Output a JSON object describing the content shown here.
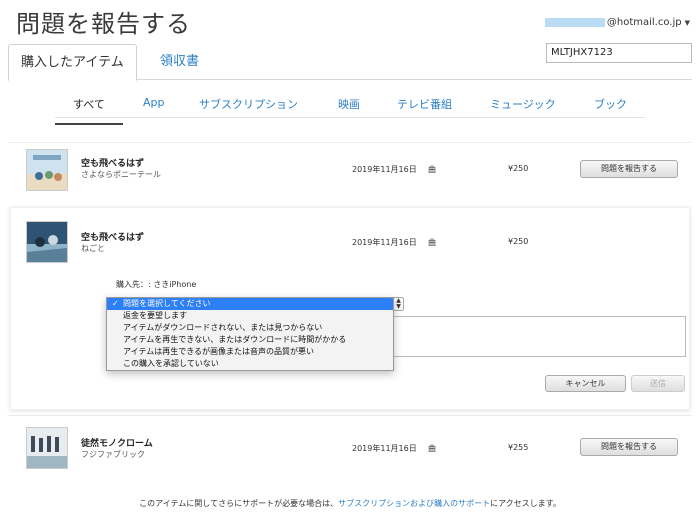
{
  "header": {
    "title": "問題を報告する",
    "account_email": "@hotmail.co.jp"
  },
  "tabs": [
    {
      "label": "購入したアイテム"
    },
    {
      "label": "領収書"
    }
  ],
  "order_search": {
    "value": "MLTJHX7123"
  },
  "filters": [
    "すべて",
    "App",
    "サブスクリプション",
    "映画",
    "テレビ番組",
    "ミュージック",
    "ブック"
  ],
  "purchases": [
    {
      "title": "空も飛べるはず",
      "artist": "さよならポニーテール",
      "date": "2019年11月16日",
      "kind": "曲",
      "price": "¥250",
      "button": "問題を報告する"
    },
    {
      "title": "空も飛べるはず",
      "artist": "ねごと",
      "date": "2019年11月16日",
      "kind": "曲",
      "price": "¥250"
    },
    {
      "title": "徒然モノクローム",
      "artist": "フジファブリック",
      "date": "2019年11月16日",
      "kind": "曲",
      "price": "¥255",
      "button": "問題を報告する"
    }
  ],
  "report_form": {
    "purchased_from": "購入先：: さきiPhone",
    "options": [
      "問題を選択してください",
      "返金を要望します",
      "アイテムがダウンロードされない、または見つからない",
      "アイテムを再生できない、またはダウンロードに時間がかかる",
      "アイテムは再生できるが画像または音声の品質が悪い",
      "この購入を承認していない"
    ],
    "selected_check": "✓",
    "cancel_label": "キャンセル",
    "submit_label": "送信"
  },
  "footer": {
    "text_before": "このアイテムに関してさらにサポートが必要な場合は、",
    "link": "サブスクリプションおよび購入のサポート",
    "text_after": "にアクセスします。"
  }
}
